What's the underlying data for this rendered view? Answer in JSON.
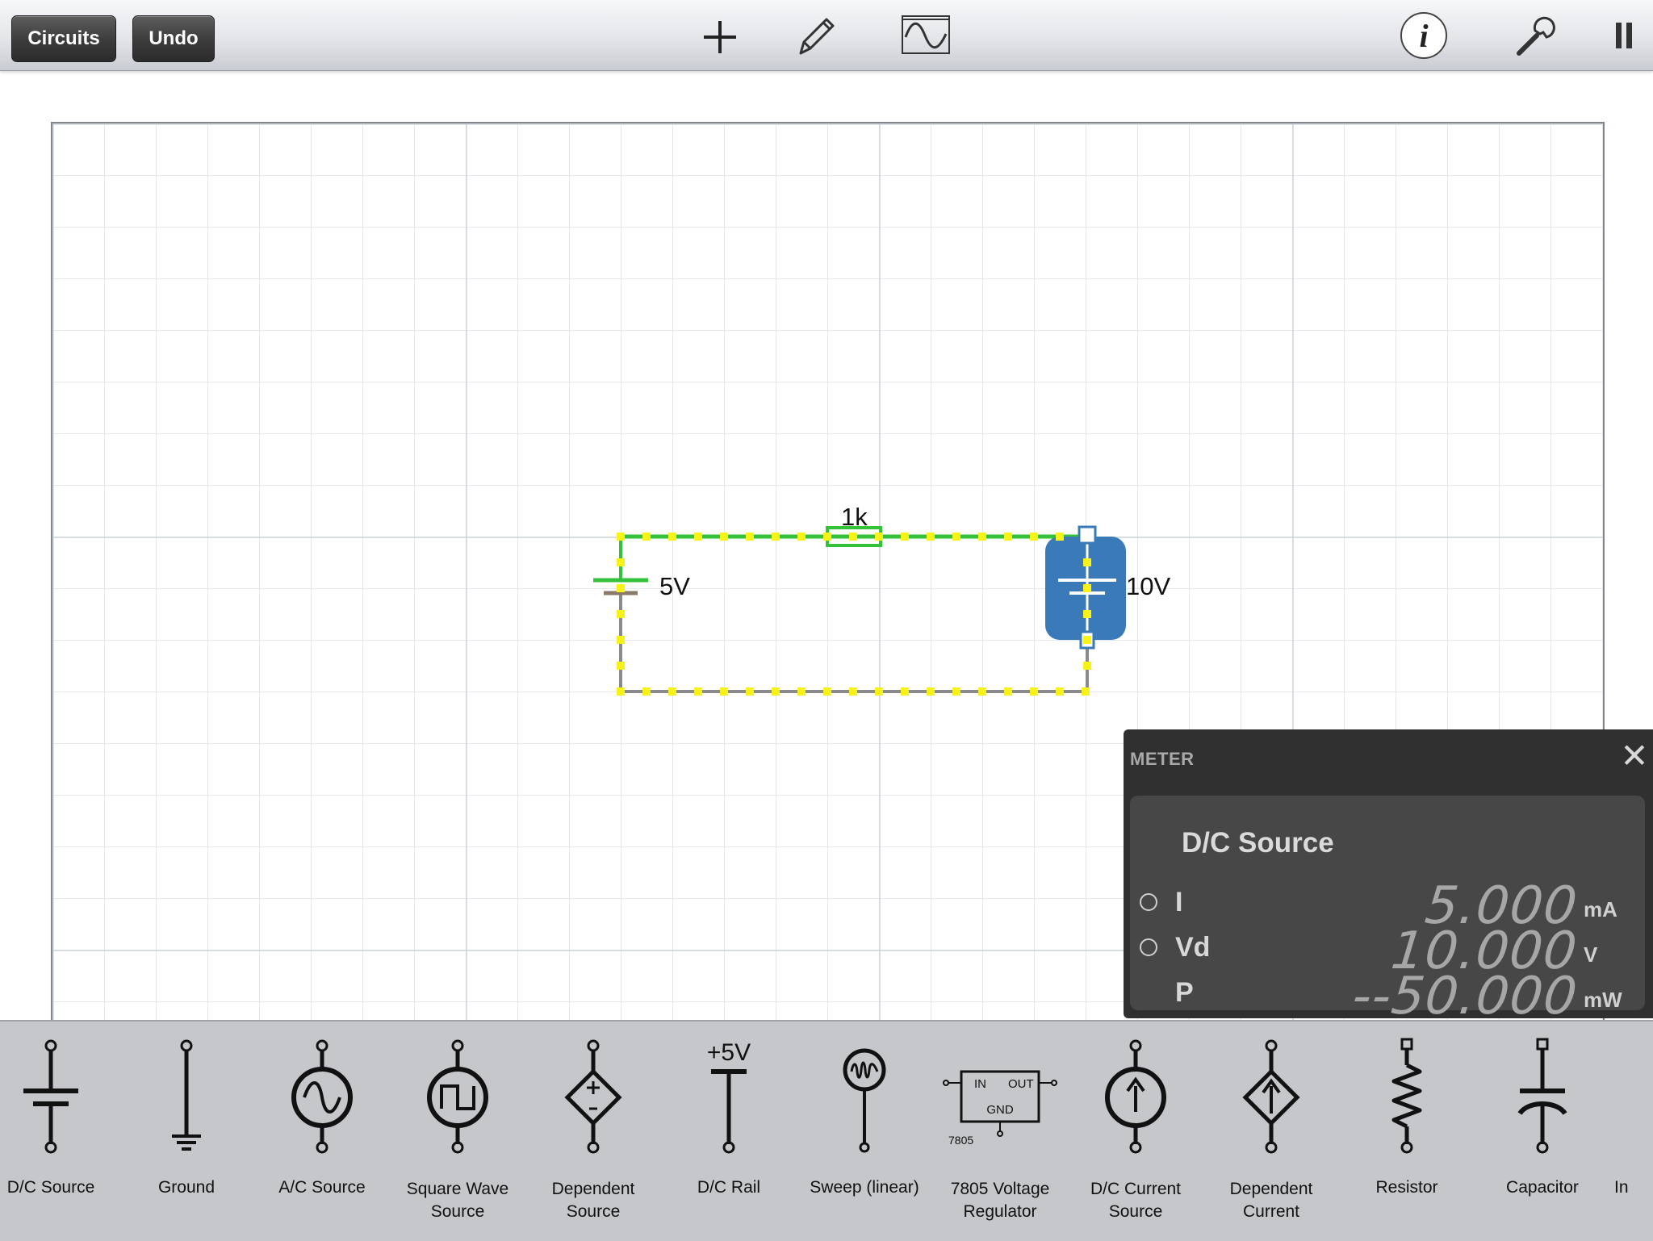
{
  "toolbar": {
    "circuits_label": "Circuits",
    "undo_label": "Undo",
    "icons": [
      "add-icon",
      "pencil-icon",
      "oscilloscope-icon",
      "info-icon",
      "wrench-icon",
      "pause-icon"
    ]
  },
  "circuit": {
    "resistor_label": "1k",
    "source_left_label": "5V",
    "source_right_label": "10V",
    "wire_color_active": "#33c23a",
    "current_dot_color": "#f7f21a",
    "selected_color": "#3a7ab8"
  },
  "meter": {
    "title": "METER",
    "component_name": "D/C Source",
    "rows": [
      {
        "label": "I",
        "value": "5.000",
        "unit": "mA",
        "has_radio": true
      },
      {
        "label": "Vd",
        "value": "10.000",
        "unit": "V",
        "has_radio": true
      },
      {
        "label": "P",
        "value": "--50.000",
        "unit": "mW",
        "has_radio": false
      }
    ]
  },
  "palette": {
    "items": [
      {
        "label": "D/C Source",
        "icon": "dc-source-icon"
      },
      {
        "label": "Ground",
        "icon": "ground-icon"
      },
      {
        "label": "A/C Source",
        "icon": "ac-source-icon"
      },
      {
        "label": "Square Wave Source",
        "icon": "square-wave-source-icon"
      },
      {
        "label": "Dependent Source",
        "icon": "dependent-source-icon"
      },
      {
        "label": "D/C Rail",
        "icon": "dc-rail-icon",
        "text": "+5V"
      },
      {
        "label": "Sweep (linear)",
        "icon": "sweep-icon"
      },
      {
        "label": "7805 Voltage Regulator",
        "icon": "voltage-regulator-icon",
        "pins": [
          "IN",
          "OUT",
          "GND",
          "7805"
        ]
      },
      {
        "label": "D/C Current Source",
        "icon": "dc-current-source-icon"
      },
      {
        "label": "Dependent Current",
        "icon": "dependent-current-icon"
      },
      {
        "label": "Resistor",
        "icon": "resistor-icon"
      },
      {
        "label": "Capacitor",
        "icon": "capacitor-icon"
      },
      {
        "label": "In",
        "icon": "inductor-icon"
      }
    ]
  }
}
